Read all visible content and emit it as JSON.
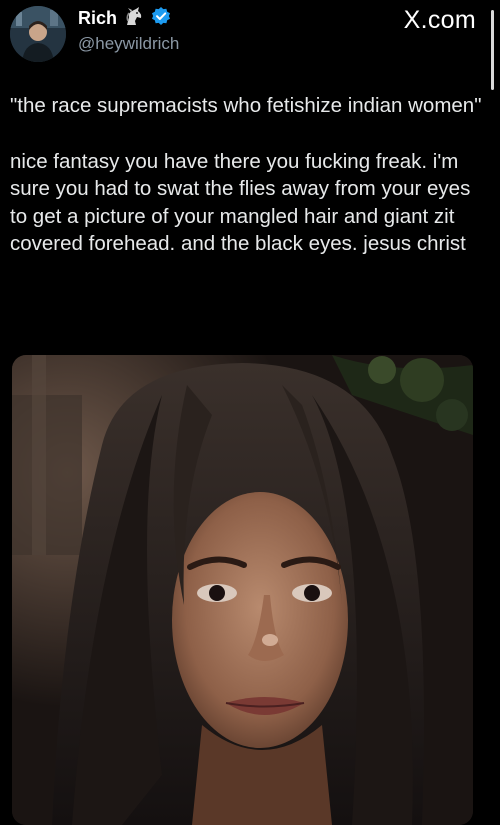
{
  "header": {
    "display_name": "Rich",
    "name_emoji": "unicorn-emoji",
    "verified_badge_color": "#1d9bf0",
    "handle": "@heywildrich",
    "brand": "X.com"
  },
  "tweet": {
    "quote_line": "\"the race supremacists who fetishize indian women\"",
    "body": "nice fantasy you have there you fucking freak. i'm sure you had to swat the flies away from your eyes to get a picture of your mangled hair and giant zit covered forehead. and the black eyes. jesus christ"
  },
  "media": {
    "kind": "selfie-photo"
  },
  "colors": {
    "background": "#000000",
    "text": "#e7e9ea",
    "secondary_text": "#8b98a5",
    "accent": "#1d9bf0"
  }
}
